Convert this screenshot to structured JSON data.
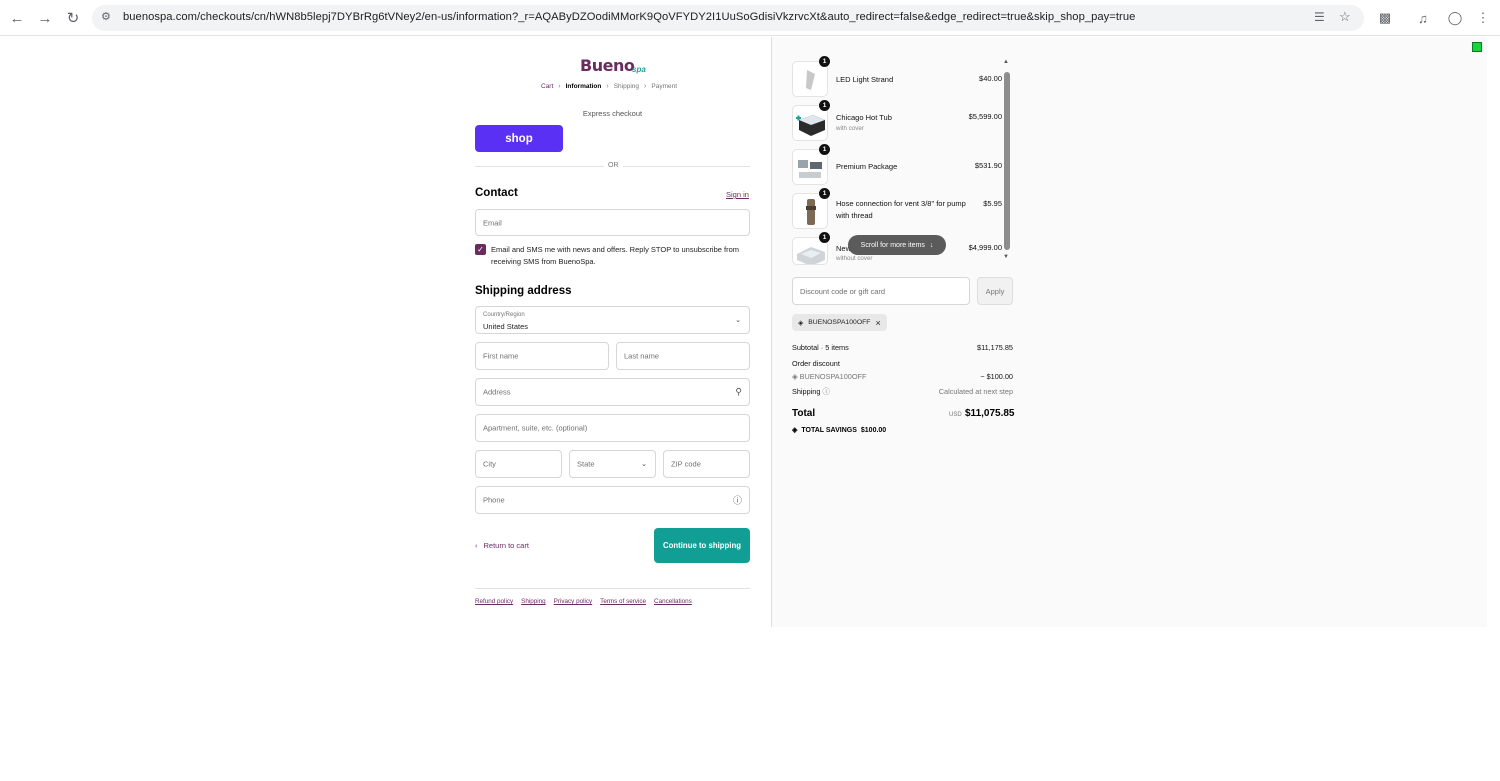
{
  "browser": {
    "url_host": "buenospa.com",
    "url_path": "/checkouts/cn/hWN8b5lepj7DYBrRg6tVNey2/en-us/information?_r=AQAByDZOodiMMorK9QoVFYDY2I1UuSoGdisiVkzrvcXt&auto_redirect=false&edge_redirect=true&skip_shop_pay=true"
  },
  "brand": {
    "name": "Bueno",
    "suffix": "spa",
    "primary_color": "#6a2c5e",
    "accent_color": "#119e94"
  },
  "breadcrumbs": [
    "Cart",
    "Information",
    "Shipping",
    "Payment"
  ],
  "express": {
    "label": "Express checkout",
    "shop_button": "shop",
    "divider": "OR"
  },
  "contact": {
    "heading": "Contact",
    "signin": "Sign in",
    "email_placeholder": "Email",
    "checkbox_label": "Email and SMS me with news and offers. Reply STOP to unsubscribe from receiving SMS from BuenoSpa."
  },
  "shipping": {
    "heading": "Shipping address",
    "country_label": "Country/Region",
    "country_value": "United States",
    "first_name": "First name",
    "last_name": "Last name",
    "address": "Address",
    "apartment": "Apartment, suite, etc. (optional)",
    "city": "City",
    "state": "State",
    "zip": "ZIP code",
    "phone": "Phone"
  },
  "actions": {
    "return": "Return to cart",
    "continue": "Continue to shipping"
  },
  "footer_links": [
    "Refund policy",
    "Shipping",
    "Privacy policy",
    "Terms of service",
    "Cancellations"
  ],
  "cart": {
    "items": [
      {
        "name": "LED Light Strand",
        "sub": "",
        "price": "$40.00",
        "qty": "1"
      },
      {
        "name": "Chicago Hot Tub",
        "sub": "with cover",
        "price": "$5,599.00",
        "qty": "1"
      },
      {
        "name": "Premium Package",
        "sub": "",
        "price": "$531.90",
        "qty": "1"
      },
      {
        "name": "Hose connection for vent 3/8\" for pump with thread",
        "sub": "",
        "price": "$5.95",
        "qty": "1"
      },
      {
        "name": "New",
        "sub": "without cover",
        "price": "$4,999.00",
        "qty": "1"
      }
    ],
    "scroll_hint": "Scroll for more items"
  },
  "discount": {
    "placeholder": "Discount code or gift card",
    "apply": "Apply",
    "applied_code": "BUENOSPA100OFF"
  },
  "summary": {
    "subtotal_label": "Subtotal · 5 items",
    "subtotal_value": "$11,175.85",
    "order_discount_label": "Order discount",
    "discount_code": "BUENOSPA100OFF",
    "discount_value": "− $100.00",
    "shipping_label": "Shipping",
    "shipping_value": "Calculated at next step",
    "total_label": "Total",
    "currency": "USD",
    "total_value": "$11,075.85",
    "savings_label": "TOTAL SAVINGS",
    "savings_value": "$100.00"
  }
}
